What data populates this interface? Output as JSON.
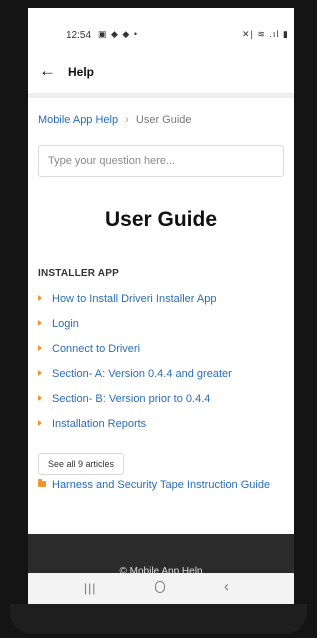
{
  "status_bar": {
    "time": "12:54",
    "left_icons": "▣ ◆ ◆ •",
    "right_icons": "✕| ≋ .ıl ▮"
  },
  "app_bar": {
    "back_icon": "←",
    "title": "Help"
  },
  "breadcrumb": {
    "parent": "Mobile App Help",
    "separator": "›",
    "current": "User Guide"
  },
  "search": {
    "placeholder": "Type your question here..."
  },
  "page_heading": "User Guide",
  "section": {
    "title": "INSTALLER APP",
    "articles": [
      "How to Install Driveri Installer App",
      "Login",
      "Connect to Driveri",
      "Section- A: Version 0.4.4 and greater",
      "Section- B: Version prior to 0.4.4",
      "Installation Reports"
    ],
    "see_all_label": "See all 9 articles"
  },
  "subcategory": {
    "label": "Harness and Security Tape Instruction Guide"
  },
  "footer": {
    "text": "© Mobile App Help"
  },
  "nav_bar": {
    "recent": "|||",
    "back": "‹"
  },
  "colors": {
    "link": "#2a6db6",
    "accent": "#f0952c",
    "footer_bg": "#2b2b2b"
  }
}
